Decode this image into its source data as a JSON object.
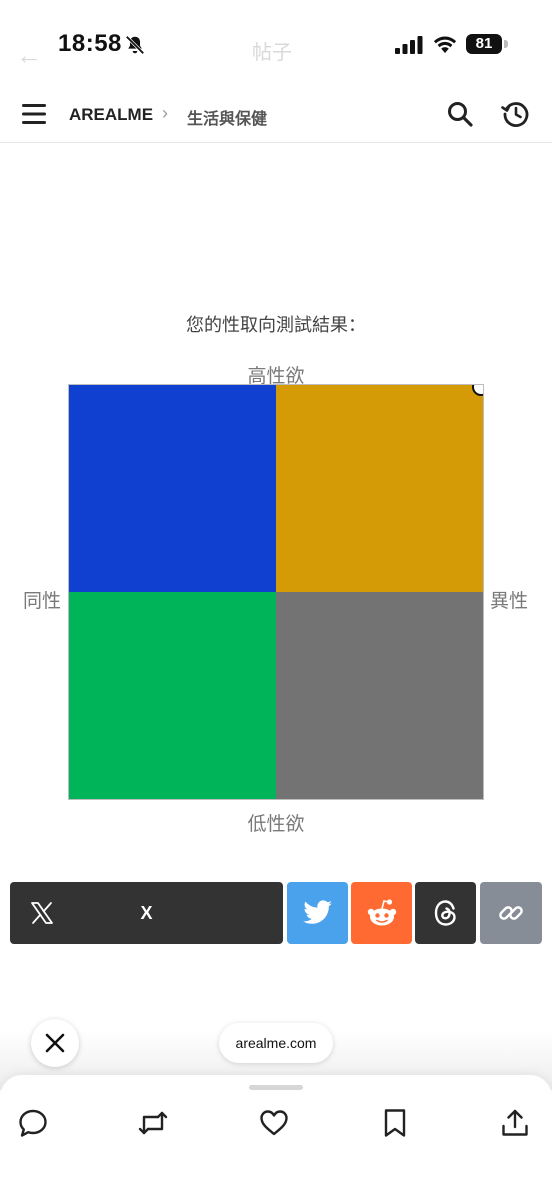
{
  "status_bar": {
    "time": "18:58",
    "battery_level": "81",
    "faded_title": "帖子"
  },
  "nav": {
    "brand": "AREALME",
    "breadcrumb_separator": "›",
    "breadcrumb_current": "生活與保健"
  },
  "result": {
    "title": "您的性取向測試結果：",
    "axis_top": "高性欲",
    "axis_bottom": "低性欲",
    "axis_left": "同性",
    "axis_right": "異性",
    "quadrant_colors": {
      "top_left": "#1040d0",
      "top_right": "#d49b07",
      "bottom_left": "#00b45a",
      "bottom_right": "#737373"
    }
  },
  "share": {
    "x_label": "X",
    "colors": {
      "x": "#333333",
      "twitter": "#4aa2ec",
      "reddit": "#ff6a32",
      "threads": "#333333",
      "link": "#878d96"
    }
  },
  "overlay": {
    "domain": "arealme.com"
  },
  "toolbar": {
    "icons": [
      "reply-icon",
      "retweet-icon",
      "like-icon",
      "bookmark-icon",
      "upload-icon"
    ]
  }
}
